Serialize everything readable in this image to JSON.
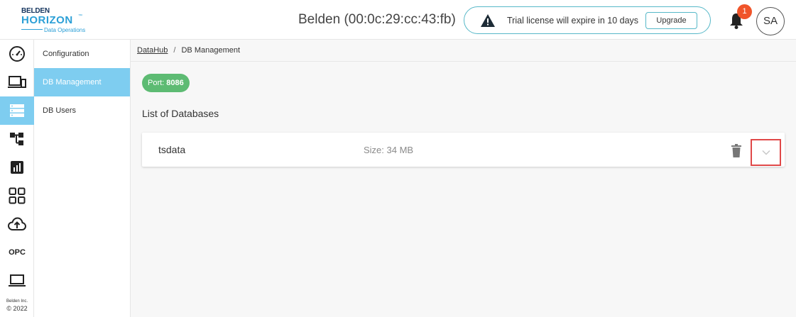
{
  "header": {
    "logo": {
      "brand": "BELDEN",
      "product": "HORIZON",
      "tm": "™",
      "tagline": "Data Operations"
    },
    "device_title": "Belden (00:0c:29:cc:43:fb)",
    "trial": {
      "message": "Trial license will expire in 10 days",
      "upgrade_label": "Upgrade",
      "icon": "warning-icon"
    },
    "notifications": {
      "count": "1",
      "icon": "bell-icon"
    },
    "avatar_initials": "SA"
  },
  "rail": {
    "items": [
      {
        "icon": "dashboard-icon"
      },
      {
        "icon": "devices-icon"
      },
      {
        "icon": "database-icon",
        "active": true
      },
      {
        "icon": "flow-icon"
      },
      {
        "icon": "chart-icon"
      },
      {
        "icon": "apps-grid-icon"
      },
      {
        "icon": "cloud-upload-icon"
      },
      {
        "label": "OPC"
      },
      {
        "icon": "laptop-icon"
      }
    ],
    "copyright_company": "Belden Inc.",
    "copyright_year": "© 2022"
  },
  "subnav": {
    "items": [
      {
        "label": "Configuration"
      },
      {
        "label": "DB Management",
        "active": true
      },
      {
        "label": "DB Users"
      }
    ]
  },
  "main": {
    "breadcrumb": {
      "root": "DataHub",
      "separator": "/",
      "current": "DB Management"
    },
    "port_label": "Port:",
    "port_value": "8086",
    "list_title": "List of Databases",
    "databases": [
      {
        "name": "tsdata",
        "size": "Size: 34 MB"
      }
    ]
  },
  "colors": {
    "accent": "#7ecdf0",
    "brand_blue": "#2b9fd6",
    "port_green": "#5dbb73",
    "badge_red": "#f0542a",
    "highlight_red": "#e04848"
  }
}
